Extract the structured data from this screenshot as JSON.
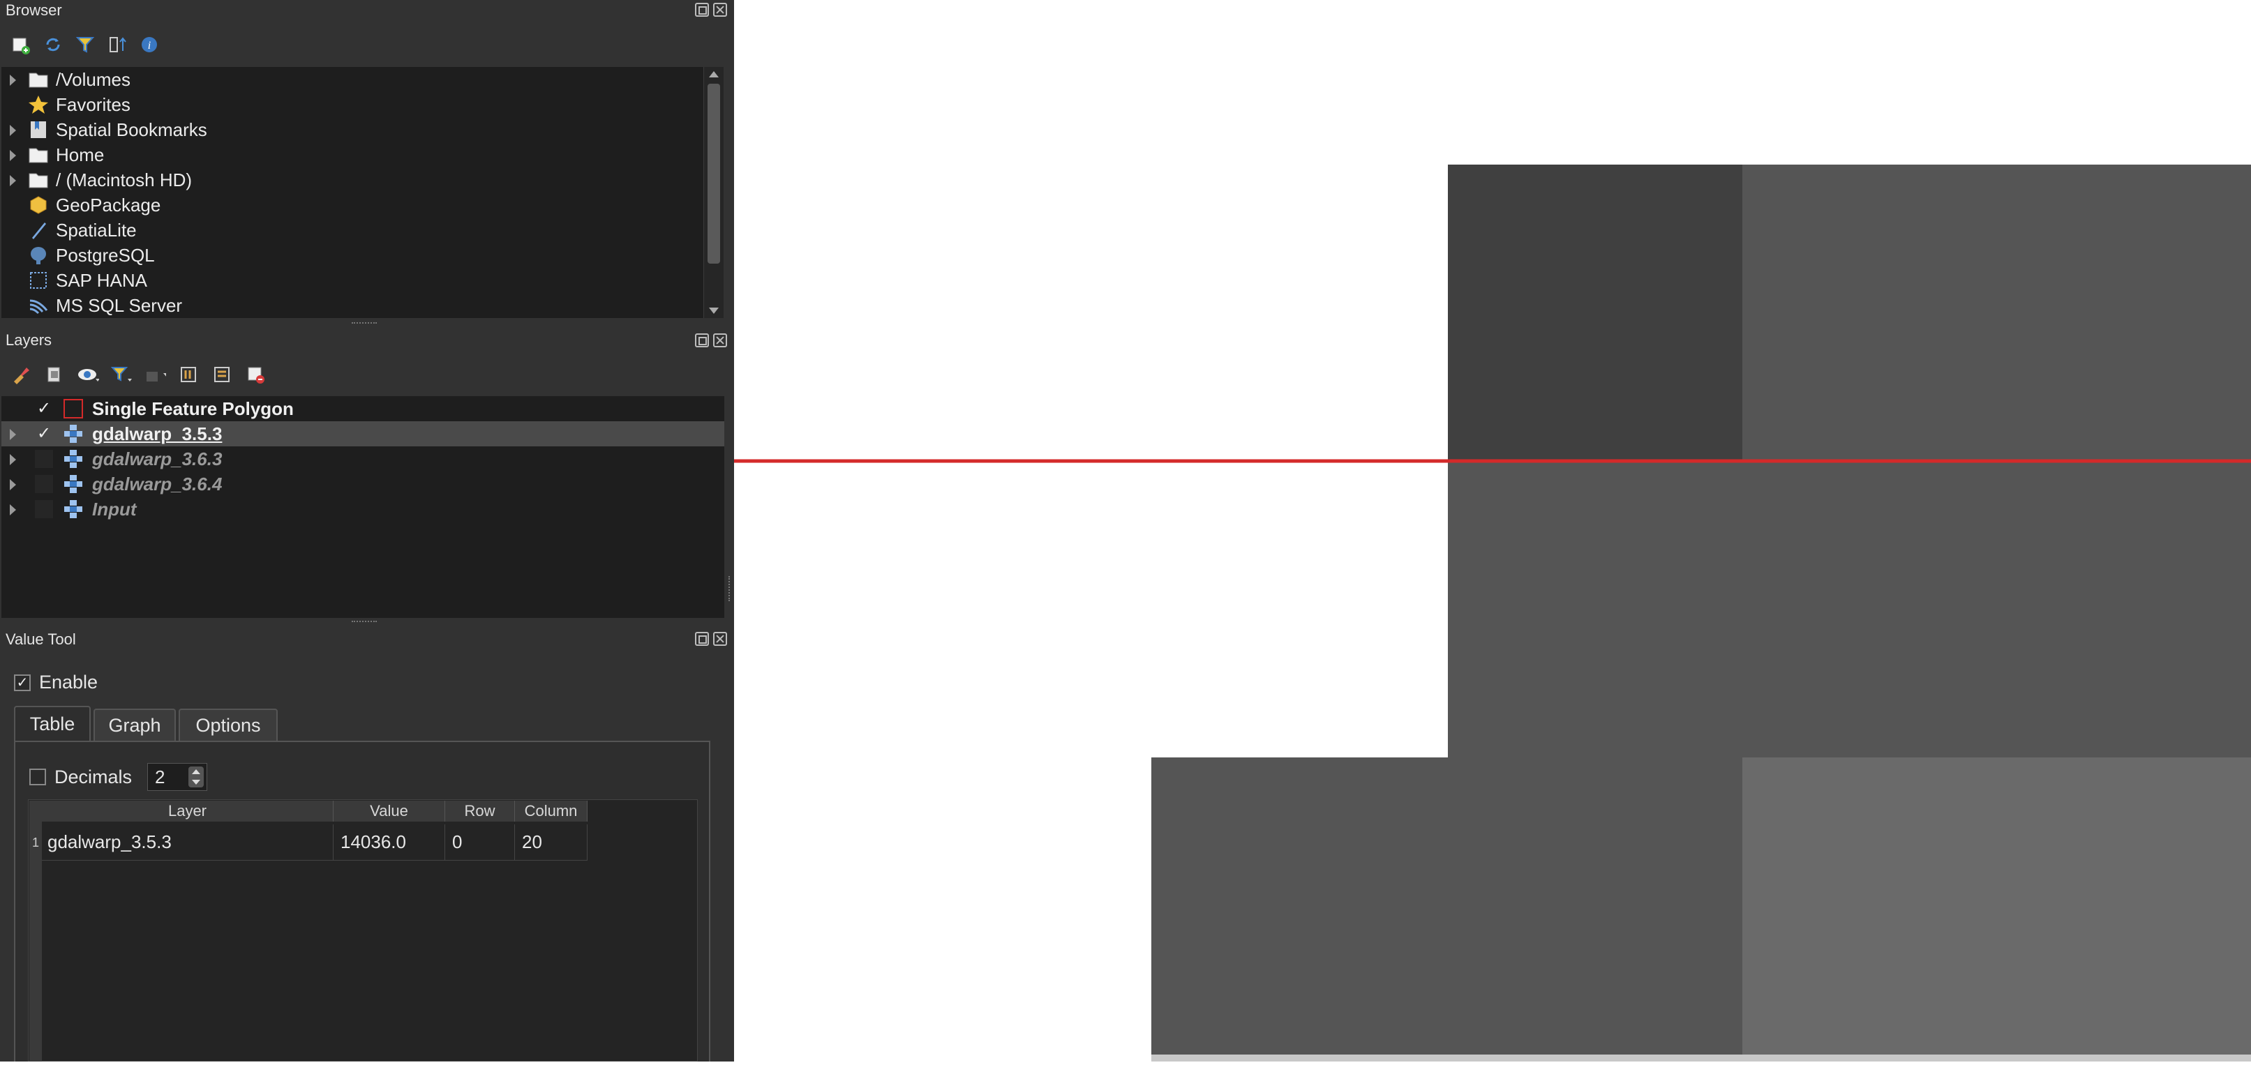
{
  "browser": {
    "title": "Browser",
    "items": [
      {
        "label": "/Volumes",
        "icon": "folder-icon",
        "expandable": true
      },
      {
        "label": "Favorites",
        "icon": "star-icon",
        "expandable": false
      },
      {
        "label": "Spatial Bookmarks",
        "icon": "bookmark-icon",
        "expandable": true
      },
      {
        "label": "Home",
        "icon": "home-folder-icon",
        "expandable": true
      },
      {
        "label": "/ (Macintosh HD)",
        "icon": "folder-icon",
        "expandable": true
      },
      {
        "label": "GeoPackage",
        "icon": "geopackage-icon",
        "expandable": false
      },
      {
        "label": "SpatiaLite",
        "icon": "spatialite-icon",
        "expandable": false
      },
      {
        "label": "PostgreSQL",
        "icon": "postgresql-icon",
        "expandable": false
      },
      {
        "label": "SAP HANA",
        "icon": "sap-hana-icon",
        "expandable": false
      },
      {
        "label": "MS SQL Server",
        "icon": "mssql-icon",
        "expandable": false
      }
    ]
  },
  "layers": {
    "title": "Layers",
    "items": [
      {
        "label": "Single Feature Polygon",
        "checked": true,
        "bold": true,
        "italic": false,
        "selected": false,
        "icon": "polygon-symbol-icon"
      },
      {
        "label": "gdalwarp_3.5.3",
        "checked": true,
        "bold": true,
        "italic": false,
        "selected": true,
        "icon": "raster-layer-icon"
      },
      {
        "label": "gdalwarp_3.6.3",
        "checked": false,
        "bold": true,
        "italic": true,
        "selected": false,
        "icon": "raster-layer-icon"
      },
      {
        "label": "gdalwarp_3.6.4",
        "checked": false,
        "bold": true,
        "italic": true,
        "selected": false,
        "icon": "raster-layer-icon"
      },
      {
        "label": "Input",
        "checked": false,
        "bold": true,
        "italic": true,
        "selected": false,
        "icon": "raster-layer-icon"
      }
    ]
  },
  "value_tool": {
    "title": "Value Tool",
    "enable_label": "Enable",
    "enable_checked": true,
    "tabs": [
      "Table",
      "Graph",
      "Options"
    ],
    "active_tab": "Table",
    "decimals_label": "Decimals",
    "decimals_value": "2",
    "columns": [
      "Layer",
      "Value",
      "Row",
      "Column"
    ],
    "rows": [
      {
        "index": "1",
        "layer": "gdalwarp_3.5.3",
        "value": "14036.0",
        "row": "0",
        "column": "20"
      }
    ]
  },
  "colors": {
    "panel_bg": "#323232",
    "tree_bg": "#1e1e1e",
    "selection_bg": "#4a4a4a",
    "polygon_line": "#d42a2a",
    "raster_dark": "#404040",
    "raster_mid": "#555555",
    "raster_light": "#6a6a6a"
  }
}
